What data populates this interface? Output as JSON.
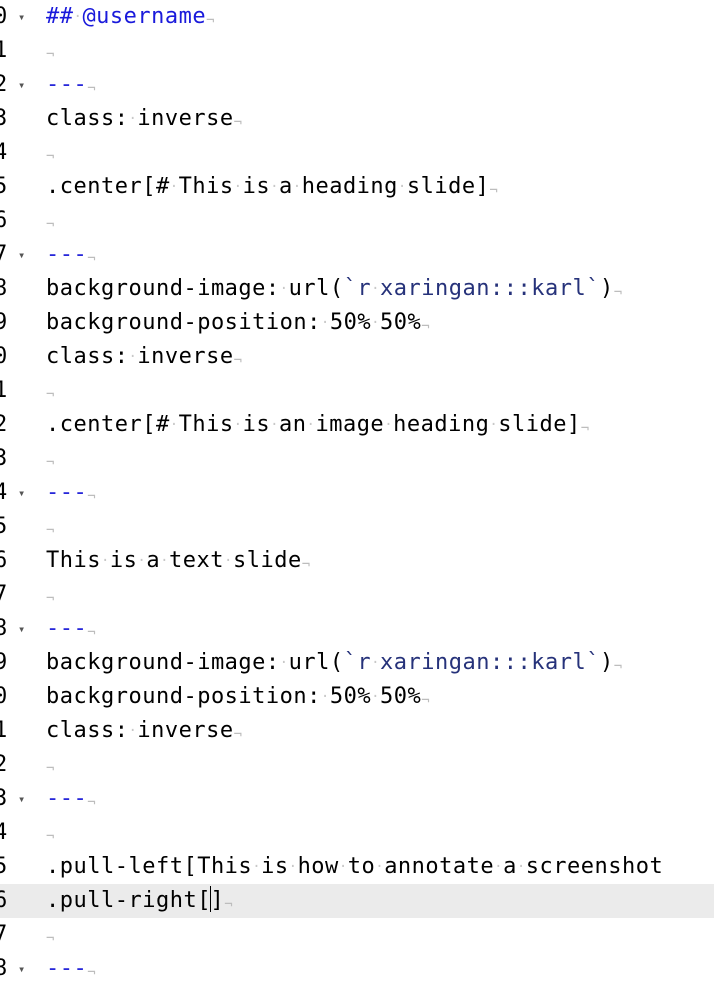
{
  "editor": {
    "lines": [
      {
        "num": "0",
        "fold": true,
        "kind": "header",
        "text": "## @username"
      },
      {
        "num": "1",
        "fold": false,
        "kind": "plain",
        "text": ""
      },
      {
        "num": "2",
        "fold": true,
        "kind": "rule",
        "text": "---"
      },
      {
        "num": "3",
        "fold": false,
        "kind": "plain",
        "text": "class: inverse"
      },
      {
        "num": "4",
        "fold": false,
        "kind": "plain",
        "text": ""
      },
      {
        "num": "5",
        "fold": false,
        "kind": "plain",
        "text": ".center[# This is a heading slide]"
      },
      {
        "num": "6",
        "fold": false,
        "kind": "plain",
        "text": ""
      },
      {
        "num": "7",
        "fold": true,
        "kind": "rule",
        "text": "---"
      },
      {
        "num": "8",
        "fold": false,
        "kind": "bgimage",
        "text": "background-image: url(`r xaringan:::karl`)"
      },
      {
        "num": "9",
        "fold": false,
        "kind": "plain",
        "text": "background-position: 50% 50%"
      },
      {
        "num": "0",
        "fold": false,
        "kind": "plain",
        "text": "class: inverse"
      },
      {
        "num": "1",
        "fold": false,
        "kind": "plain",
        "text": ""
      },
      {
        "num": "2",
        "fold": false,
        "kind": "plain",
        "text": ".center[# This is an image heading slide]"
      },
      {
        "num": "3",
        "fold": false,
        "kind": "plain",
        "text": ""
      },
      {
        "num": "4",
        "fold": true,
        "kind": "rule",
        "text": "---"
      },
      {
        "num": "5",
        "fold": false,
        "kind": "plain",
        "text": ""
      },
      {
        "num": "6",
        "fold": false,
        "kind": "plain",
        "text": "This is a text slide"
      },
      {
        "num": "7",
        "fold": false,
        "kind": "plain",
        "text": ""
      },
      {
        "num": "8",
        "fold": true,
        "kind": "rule",
        "text": "---"
      },
      {
        "num": "9",
        "fold": false,
        "kind": "bgimage",
        "text": "background-image: url(`r xaringan:::karl`)"
      },
      {
        "num": "0",
        "fold": false,
        "kind": "plain",
        "text": "background-position: 50% 50%"
      },
      {
        "num": "1",
        "fold": false,
        "kind": "plain",
        "text": "class: inverse"
      },
      {
        "num": "2",
        "fold": false,
        "kind": "plain",
        "text": ""
      },
      {
        "num": "3",
        "fold": true,
        "kind": "rule",
        "text": "---"
      },
      {
        "num": "4",
        "fold": false,
        "kind": "plain",
        "text": ""
      },
      {
        "num": "5",
        "fold": false,
        "kind": "plain",
        "text": ".pull-left[This is how to annotate a screenshot"
      },
      {
        "num": "6",
        "fold": false,
        "kind": "cursor",
        "text": ".pull-right[]",
        "active": true
      },
      {
        "num": "7",
        "fold": false,
        "kind": "plain",
        "text": ""
      },
      {
        "num": "8",
        "fold": true,
        "kind": "rule",
        "text": "---"
      }
    ]
  },
  "colors": {
    "header": "#1a1adb",
    "rule": "#2626d9",
    "rcode": "#26327a",
    "active_line": "#ebebeb"
  },
  "icons": {
    "fold": "fold-arrow-icon",
    "eol": "pilcrow-eol-icon"
  }
}
